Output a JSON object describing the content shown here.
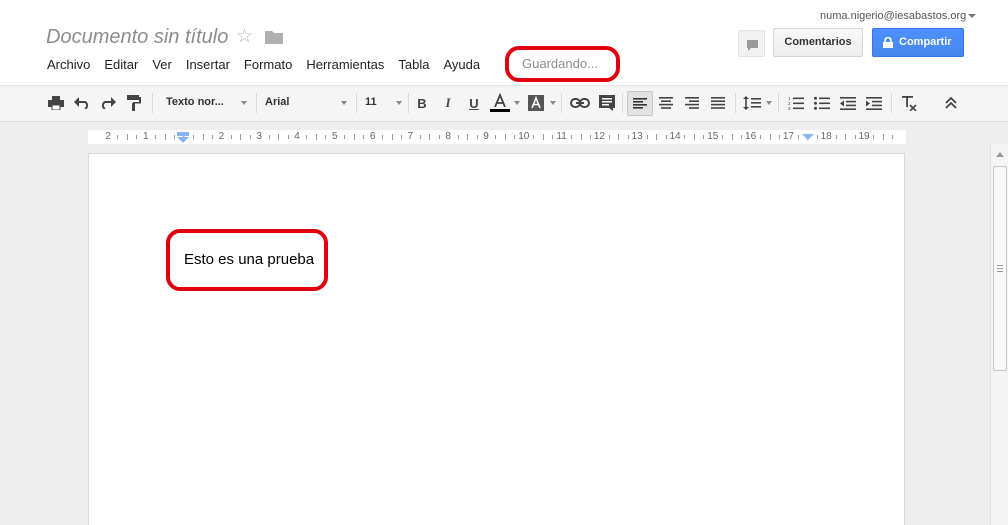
{
  "document": {
    "title": "Documento sin título",
    "save_status": "Guardando...",
    "body_text": "Esto es una prueba"
  },
  "menu": [
    "Archivo",
    "Editar",
    "Ver",
    "Insertar",
    "Formato",
    "Herramientas",
    "Tabla",
    "Ayuda"
  ],
  "account": {
    "email": "numa.nigerio@iesabastos.org"
  },
  "buttons": {
    "comments": "Comentarios",
    "share": "Compartir"
  },
  "toolbar": {
    "style": "Texto nor...",
    "font": "Arial",
    "font_size": "11"
  },
  "ruler": {
    "labels": [
      "2",
      "1",
      "1",
      "2",
      "3",
      "4",
      "5",
      "6",
      "7",
      "8",
      "9",
      "10",
      "11",
      "12",
      "13",
      "14",
      "15",
      "16",
      "17",
      "18",
      "19"
    ]
  },
  "colors": {
    "share_blue": "#4d90fe",
    "highlight_red": "#e0000d",
    "indent_marker": "#8ab4f8"
  }
}
